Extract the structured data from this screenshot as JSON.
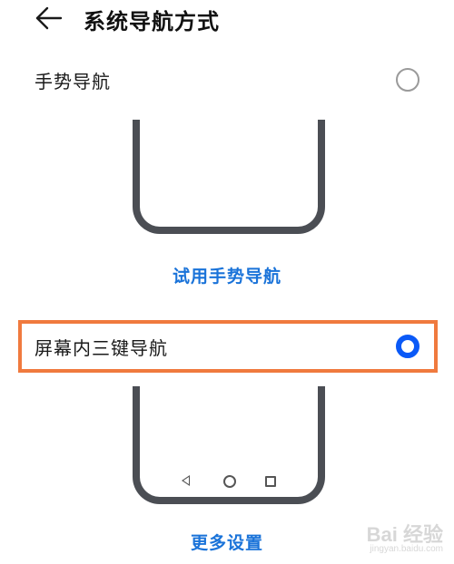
{
  "header": {
    "back_icon": "arrow-left-icon",
    "title": "系统导航方式"
  },
  "options": [
    {
      "label": "手势导航",
      "selected": false,
      "action_link": "试用手势导航"
    },
    {
      "label": "屏幕内三键导航",
      "selected": true,
      "nav_icons": [
        "back-triangle-icon",
        "home-circle-icon",
        "recent-square-icon"
      ],
      "action_link": "更多设置"
    }
  ],
  "colors": {
    "accent": "#0a59f7",
    "link": "#1a73d9",
    "phone_frame": "#4b4e54",
    "highlight_border": "#f07a3e"
  },
  "watermark": {
    "main": "Bai 经验",
    "sub": "jingyan.baidu.com"
  }
}
